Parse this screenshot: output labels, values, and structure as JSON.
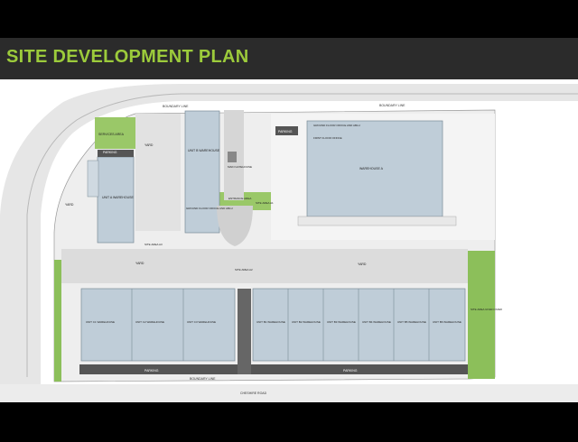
{
  "title": "SITE DEVELOPMENT PLAN",
  "colors": {
    "title_green": "#9ccb3b",
    "header_bar": "#2b2b2b",
    "roof": "#bfcdd8",
    "road": "#dcdcdc",
    "grass": "#8cbf5a",
    "parking_strip": "#555555"
  },
  "labels": {
    "boundary_top": "BOUNDARY LINE",
    "boundary_top2": "BOUNDARY LINE",
    "boundary_left": "BOUNDARY LINE",
    "boundary_right": "BOUNDARY LINE",
    "boundary_bottom": "BOUNDARY LINE",
    "road_bottom": "CHESHIRE ROAD",
    "services_area": "SERVICES AREA",
    "yard_1": "YARD",
    "yard_2": "YARD",
    "yard_3": "YARD",
    "yard_4": "YARD",
    "parking_1": "PARKING",
    "parking_2": "PARKING",
    "parking_3": "PARKING",
    "parking_4": "PARKING",
    "unit_a_wh": "UNIT A WAREHOUSE",
    "unit_b_wh": "UNIT B WAREHOUSE",
    "ground_office": "GROUND FLOOR OFFICE AND ABLU",
    "first_office": "FIRST FLOOR OFFICE",
    "warehouse_a": "WAREHOUSE A",
    "main_gatehouse": "MAIN GATEHOUSE",
    "entrance_area": "ENTRANCE AREA",
    "site_area_a1": "SITE AREA A1",
    "site_area_a2": "SITE AREA A2",
    "site_area_a3": "SITE AREA A3",
    "site_area_given": "SITE AREA GIVEN OVER",
    "landscaping": "LANDSCAPING"
  },
  "units_bottom": [
    {
      "name": "UNIT C1 WAREHOUSE"
    },
    {
      "name": "UNIT C2 WAREHOUSE"
    },
    {
      "name": "UNIT C3 WAREHOUSE"
    },
    {
      "name": "UNIT B1 WAREHOUSE"
    },
    {
      "name": "UNIT B2 WAREHOUSE"
    },
    {
      "name": "UNIT B3 WAREHOUSE"
    },
    {
      "name": "UNIT B4 WAREHOUSE"
    },
    {
      "name": "UNIT B5 WAREHOUSE"
    },
    {
      "name": "UNIT B6 WAREHOUSE"
    }
  ]
}
